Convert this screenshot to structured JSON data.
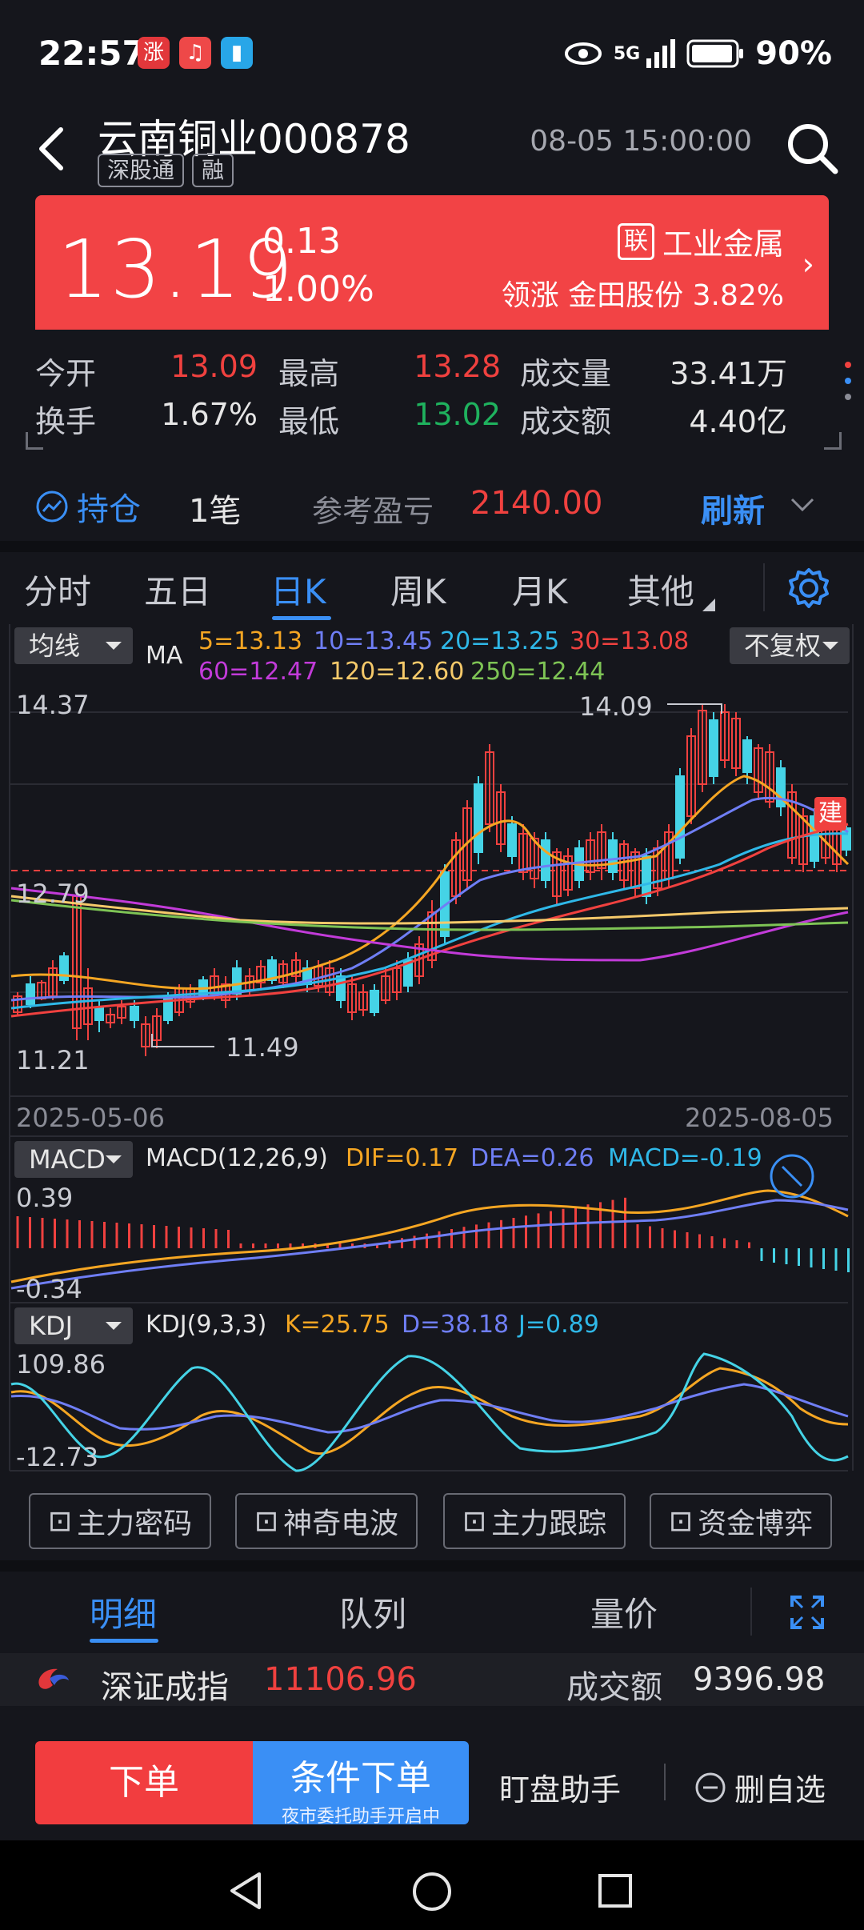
{
  "status": {
    "time": "22:57",
    "apps": [
      {
        "icon": "stock-app-icon",
        "glyph": "涨",
        "color": "#e2373b"
      },
      {
        "icon": "music-icon",
        "glyph": "♫",
        "color": "#ee4848"
      },
      {
        "icon": "book-icon",
        "glyph": "▮",
        "color": "#28a6e8"
      }
    ],
    "network": "5G",
    "battery": "90%"
  },
  "header": {
    "name": "云南铜业",
    "code": "000878",
    "tags": [
      "深股通",
      "融"
    ],
    "datetime": "08-05 15:00:00"
  },
  "quote": {
    "price": "13.19",
    "change": "0.13",
    "change_pct": "1.00%",
    "sector_badge": "联",
    "sector": "工业金属",
    "lead_label": "领涨",
    "lead_stock": "金田股份",
    "lead_pct": "3.82%",
    "up_color": "#f24345"
  },
  "stats": [
    {
      "label": "今开",
      "value": "13.09",
      "tone": "red"
    },
    {
      "label": "最高",
      "value": "13.28",
      "tone": "red"
    },
    {
      "label": "成交量",
      "value": "33.41万",
      "tone": "white"
    },
    {
      "label": "换手",
      "value": "1.67%",
      "tone": "white"
    },
    {
      "label": "最低",
      "value": "13.02",
      "tone": "green"
    },
    {
      "label": "成交额",
      "value": "4.40亿",
      "tone": "white"
    }
  ],
  "position": {
    "label": "持仓",
    "count": "1笔",
    "pnl_label": "参考盈亏",
    "pnl_value": "2140.00",
    "refresh": "刷新"
  },
  "tabs": [
    "分时",
    "五日",
    "日K",
    "周K",
    "月K",
    "其他"
  ],
  "active_tab": 2,
  "chart": {
    "ma_dropdown": "均线",
    "ma_label": "MA",
    "ma": [
      {
        "text": "5=13.13",
        "color": "#f5a623"
      },
      {
        "text": "10=13.45",
        "color": "#6f7ef5"
      },
      {
        "text": "20=13.25",
        "color": "#2fb8e8"
      },
      {
        "text": "30=13.08",
        "color": "#f0413f"
      },
      {
        "text": "60=12.47",
        "color": "#c23bd9"
      },
      {
        "text": "120=12.60",
        "color": "#f5c96a"
      },
      {
        "text": "250=12.44",
        "color": "#7ec455"
      }
    ],
    "adjust": "不复权",
    "y_max": "14.37",
    "y_mid": "12.79",
    "y_min": "11.21",
    "high_mark": "14.09",
    "low_mark": "11.49",
    "date_start": "2025-05-06",
    "date_end": "2025-08-05",
    "build_badge": "建",
    "macd_dropdown": "MACD",
    "macd_params": "MACD(12,26,9)",
    "dif": "DIF=0.17",
    "dea": "DEA=0.26",
    "macd": "MACD=-0.19",
    "macd_top": "0.39",
    "macd_bottom": "-0.34",
    "kdj_dropdown": "KDJ",
    "kdj_params": "KDJ(9,3,3)",
    "k": "K=25.75",
    "d": "D=38.18",
    "j": "J=0.89",
    "kdj_top": "109.86",
    "kdj_bottom": "-12.73"
  },
  "tools": [
    "主力密码",
    "神奇电波",
    "主力跟踪",
    "资金博弈"
  ],
  "sub_tabs": [
    "明细",
    "队列",
    "量价"
  ],
  "index": {
    "name": "深证成指",
    "value": "11106.96",
    "turnover_label": "成交额",
    "turnover": "9396.98"
  },
  "bottom": {
    "buy": "下单",
    "conditional": "条件下单",
    "conditional_sub": "夜市委托助手开启中",
    "monitor": "盯盘助手",
    "remove": "删自选"
  }
}
